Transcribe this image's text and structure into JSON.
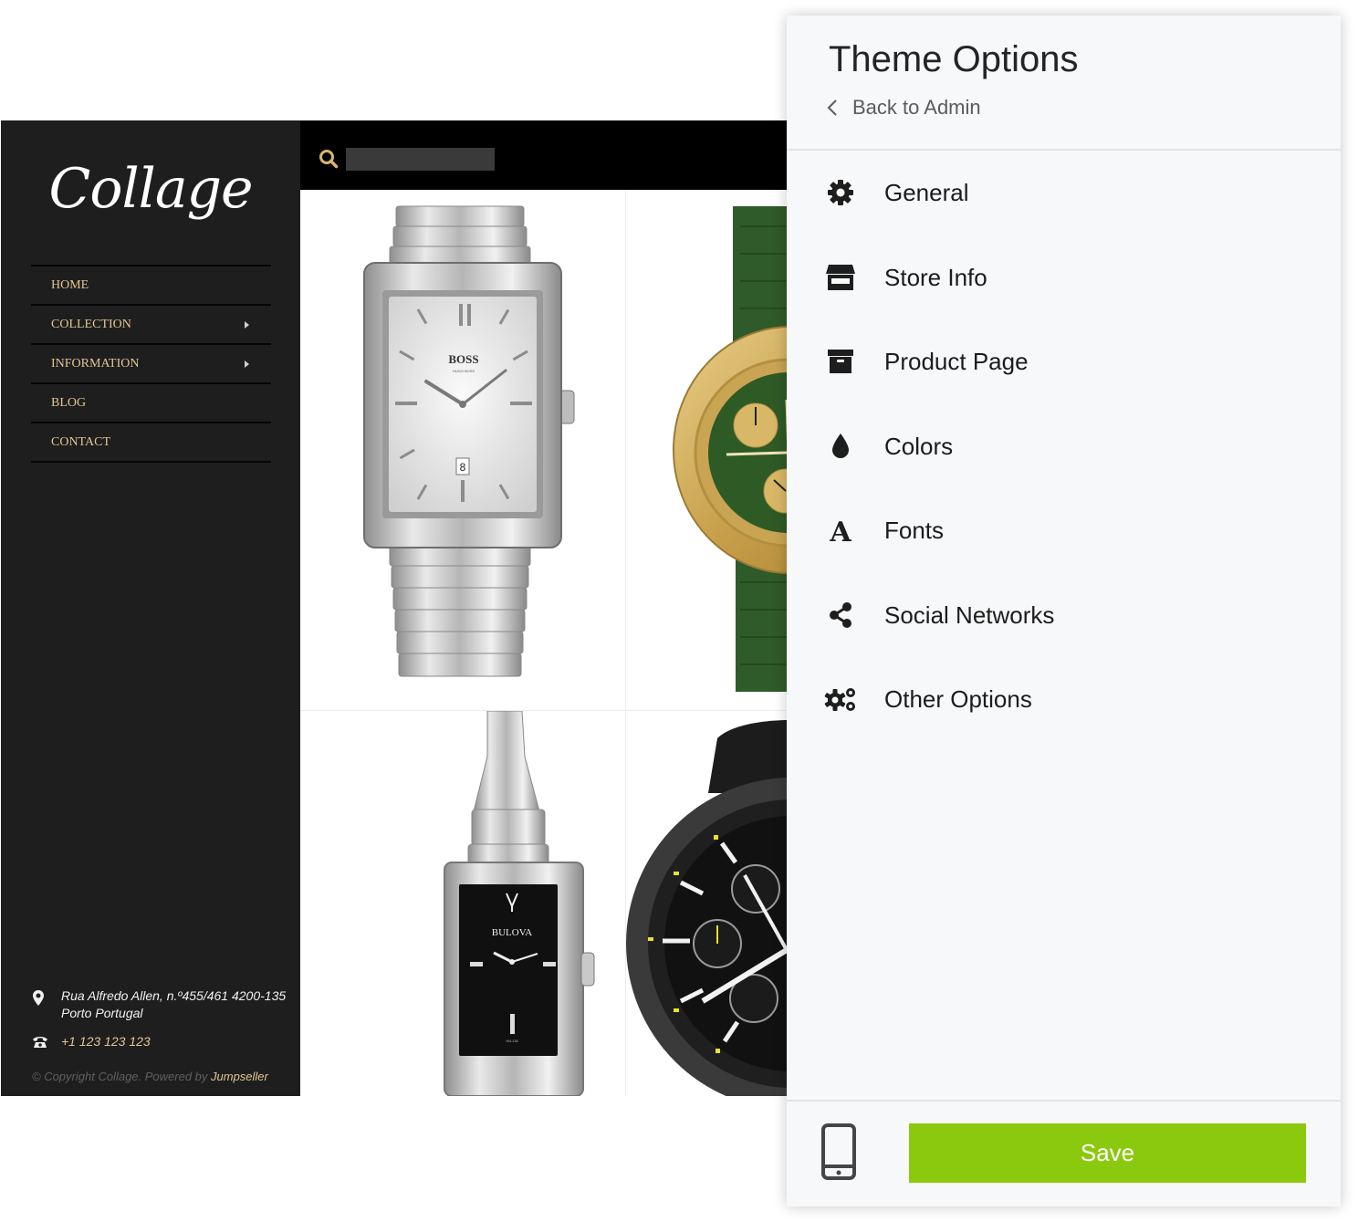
{
  "store": {
    "logo_text": "Collage",
    "nav": {
      "home": "HOME",
      "collection": "COLLECTION",
      "information": "INFORMATION",
      "blog": "BLOG",
      "contact": "CONTACT"
    },
    "contact": {
      "address_line1": "Rua Alfredo Allen, n.º455/461 4200-135",
      "address_line2": "Porto Portugal",
      "phone": "+1 123 123 123"
    },
    "copyright": {
      "text": "© Copyright Collage. Powered by ",
      "brand": "Jumpseller"
    },
    "search": {
      "value": ""
    },
    "products": [
      {
        "brand": "BOSS",
        "sub": "HUGO BOSS",
        "date": "8"
      },
      {
        "brand": ""
      },
      {
        "brand": "BULOVA",
        "ref": "96L138"
      },
      {
        "brand": ""
      }
    ],
    "colors": {
      "sidebar": "#1e1e1e",
      "accent": "#e2c693",
      "search_bar": "#000000"
    }
  },
  "panel": {
    "title": "Theme Options",
    "back_label": "Back to Admin",
    "menu": [
      {
        "label": "General",
        "icon": "gear-icon"
      },
      {
        "label": "Store Info",
        "icon": "store-icon"
      },
      {
        "label": "Product Page",
        "icon": "archive-box-icon"
      },
      {
        "label": "Colors",
        "icon": "droplet-icon"
      },
      {
        "label": "Fonts",
        "icon": "font-icon"
      },
      {
        "label": "Social Networks",
        "icon": "share-icon"
      },
      {
        "label": "Other Options",
        "icon": "gears-icon"
      }
    ],
    "footer": {
      "device_icon": "mobile-phone-icon",
      "save_label": "Save"
    },
    "colors": {
      "save_button": "#8bc90e",
      "panel_bg": "#f7f8f9"
    }
  }
}
